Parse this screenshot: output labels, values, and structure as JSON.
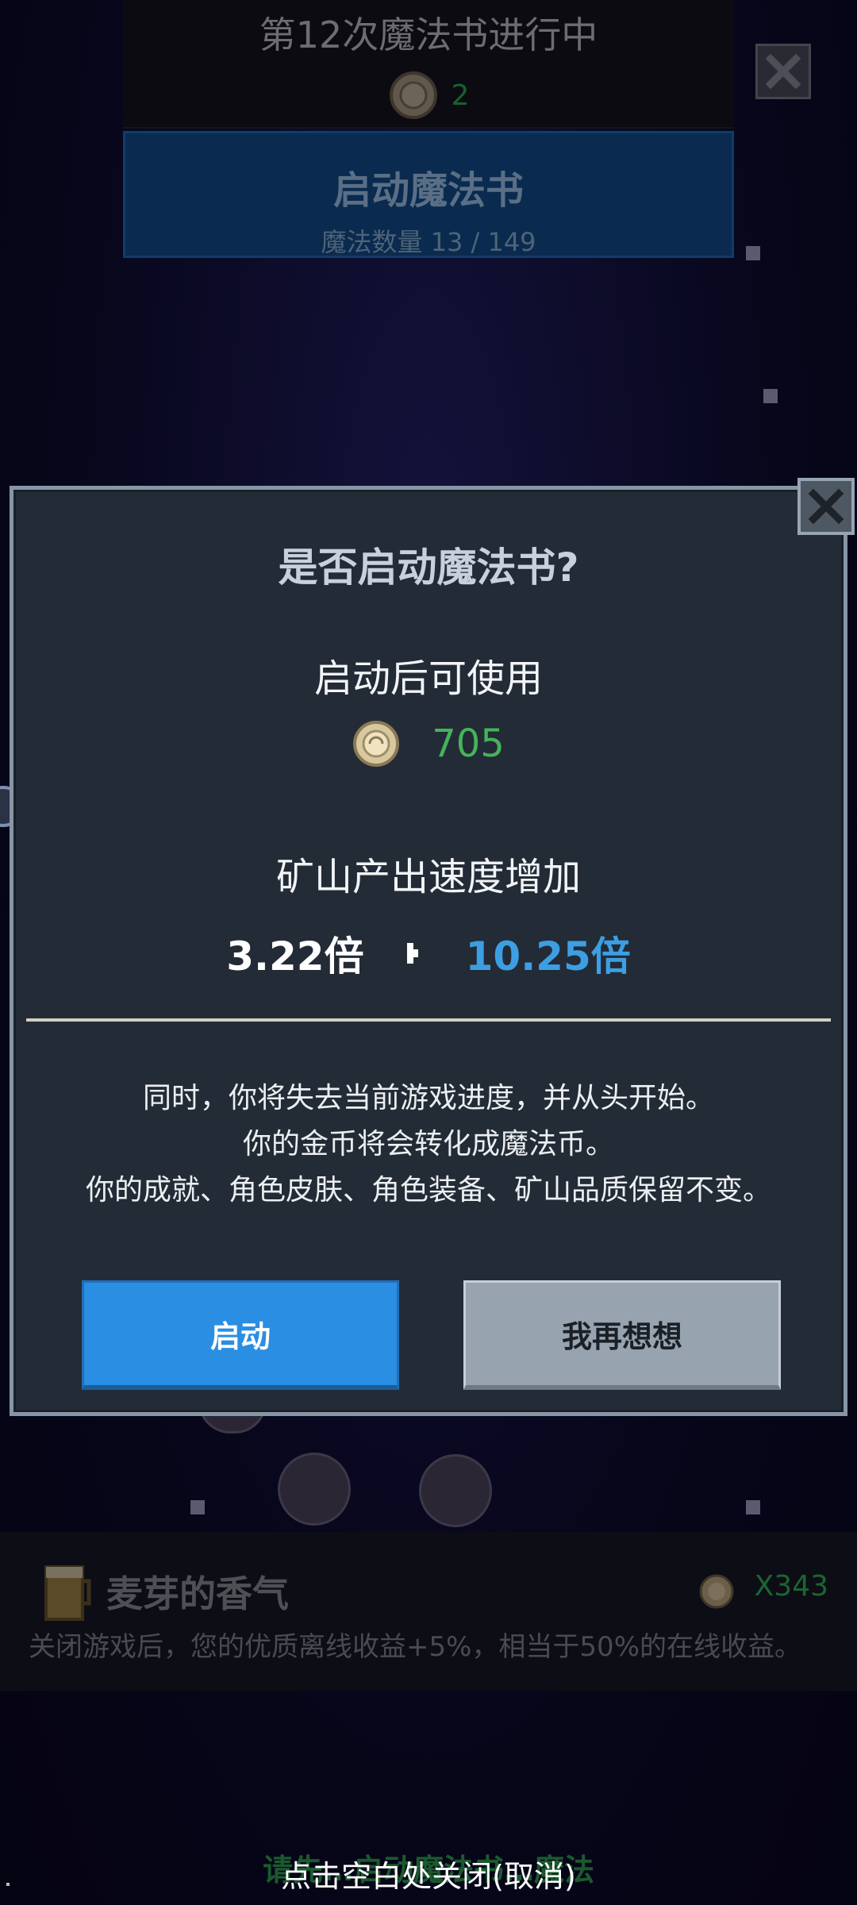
{
  "top": {
    "title": "第12次魔法书进行中",
    "coin_value": "2",
    "activate_title": "启动魔法书",
    "activate_sub": "魔法数量 13 / 149",
    "close_icon": "close-icon"
  },
  "background_item": {
    "title": "麦芽的香气",
    "description": "关闭游戏后，您的优质离线收益+5%，相当于50%的在线收益。",
    "count": "X343",
    "icon": "beer-mug-icon"
  },
  "background_footer_hint": "请先…启动魔法书…魔法",
  "dialog": {
    "title": "是否启动魔法书?",
    "available_label": "启动后可使用",
    "coin_value": "705",
    "speed_label": "矿山产出速度增加",
    "mult_old": "3.22倍",
    "mult_new": "10.25倍",
    "warning_lines": [
      "同时，你将失去当前游戏进度，并从头开始。",
      "你的金币将会转化成魔法币。",
      "你的成就、角色皮肤、角色装备、矿山品质保留不变。"
    ],
    "start_button": "启动",
    "think_button": "我再想想"
  },
  "close_hint": "点击空白处关闭(取消)",
  "colors": {
    "coin_green": "#45b35b",
    "mult_blue": "#3d9fe3",
    "start_button": "#2a8ee3",
    "think_button": "#97a3ae",
    "dialog_bg": "#232b36"
  }
}
